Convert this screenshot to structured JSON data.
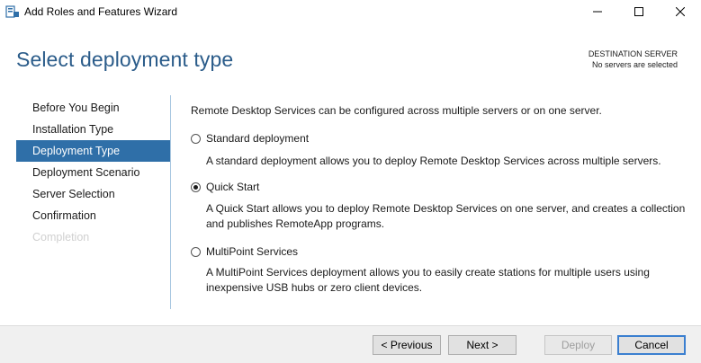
{
  "window": {
    "title": "Add Roles and Features Wizard"
  },
  "header": {
    "title": "Select deployment type",
    "destination_label": "DESTINATION SERVER",
    "destination_value": "No servers are selected"
  },
  "sidebar": {
    "items": [
      {
        "label": "Before You Begin",
        "state": "normal"
      },
      {
        "label": "Installation Type",
        "state": "normal"
      },
      {
        "label": "Deployment Type",
        "state": "active"
      },
      {
        "label": "Deployment Scenario",
        "state": "normal"
      },
      {
        "label": "Server Selection",
        "state": "normal"
      },
      {
        "label": "Confirmation",
        "state": "normal"
      },
      {
        "label": "Completion",
        "state": "disabled"
      }
    ]
  },
  "main": {
    "intro": "Remote Desktop Services can be configured across multiple servers or on one server.",
    "options": [
      {
        "label": "Standard deployment",
        "description": "A standard deployment allows you to deploy Remote Desktop Services across multiple servers.",
        "selected": false
      },
      {
        "label": "Quick Start",
        "description": "A Quick Start allows you to deploy Remote Desktop Services on one server, and creates a collection and publishes RemoteApp programs.",
        "selected": true
      },
      {
        "label": "MultiPoint Services",
        "description": "A MultiPoint Services deployment allows you to easily create stations for multiple users using inexpensive USB hubs or zero client devices.",
        "selected": false
      }
    ]
  },
  "footer": {
    "previous_label": "< Previous",
    "next_label": "Next >",
    "deploy_label": "Deploy",
    "cancel_label": "Cancel"
  },
  "colors": {
    "accent": "#2f6fa8",
    "title_blue": "#2b5c8a",
    "focus_border": "#3b7fd0"
  }
}
